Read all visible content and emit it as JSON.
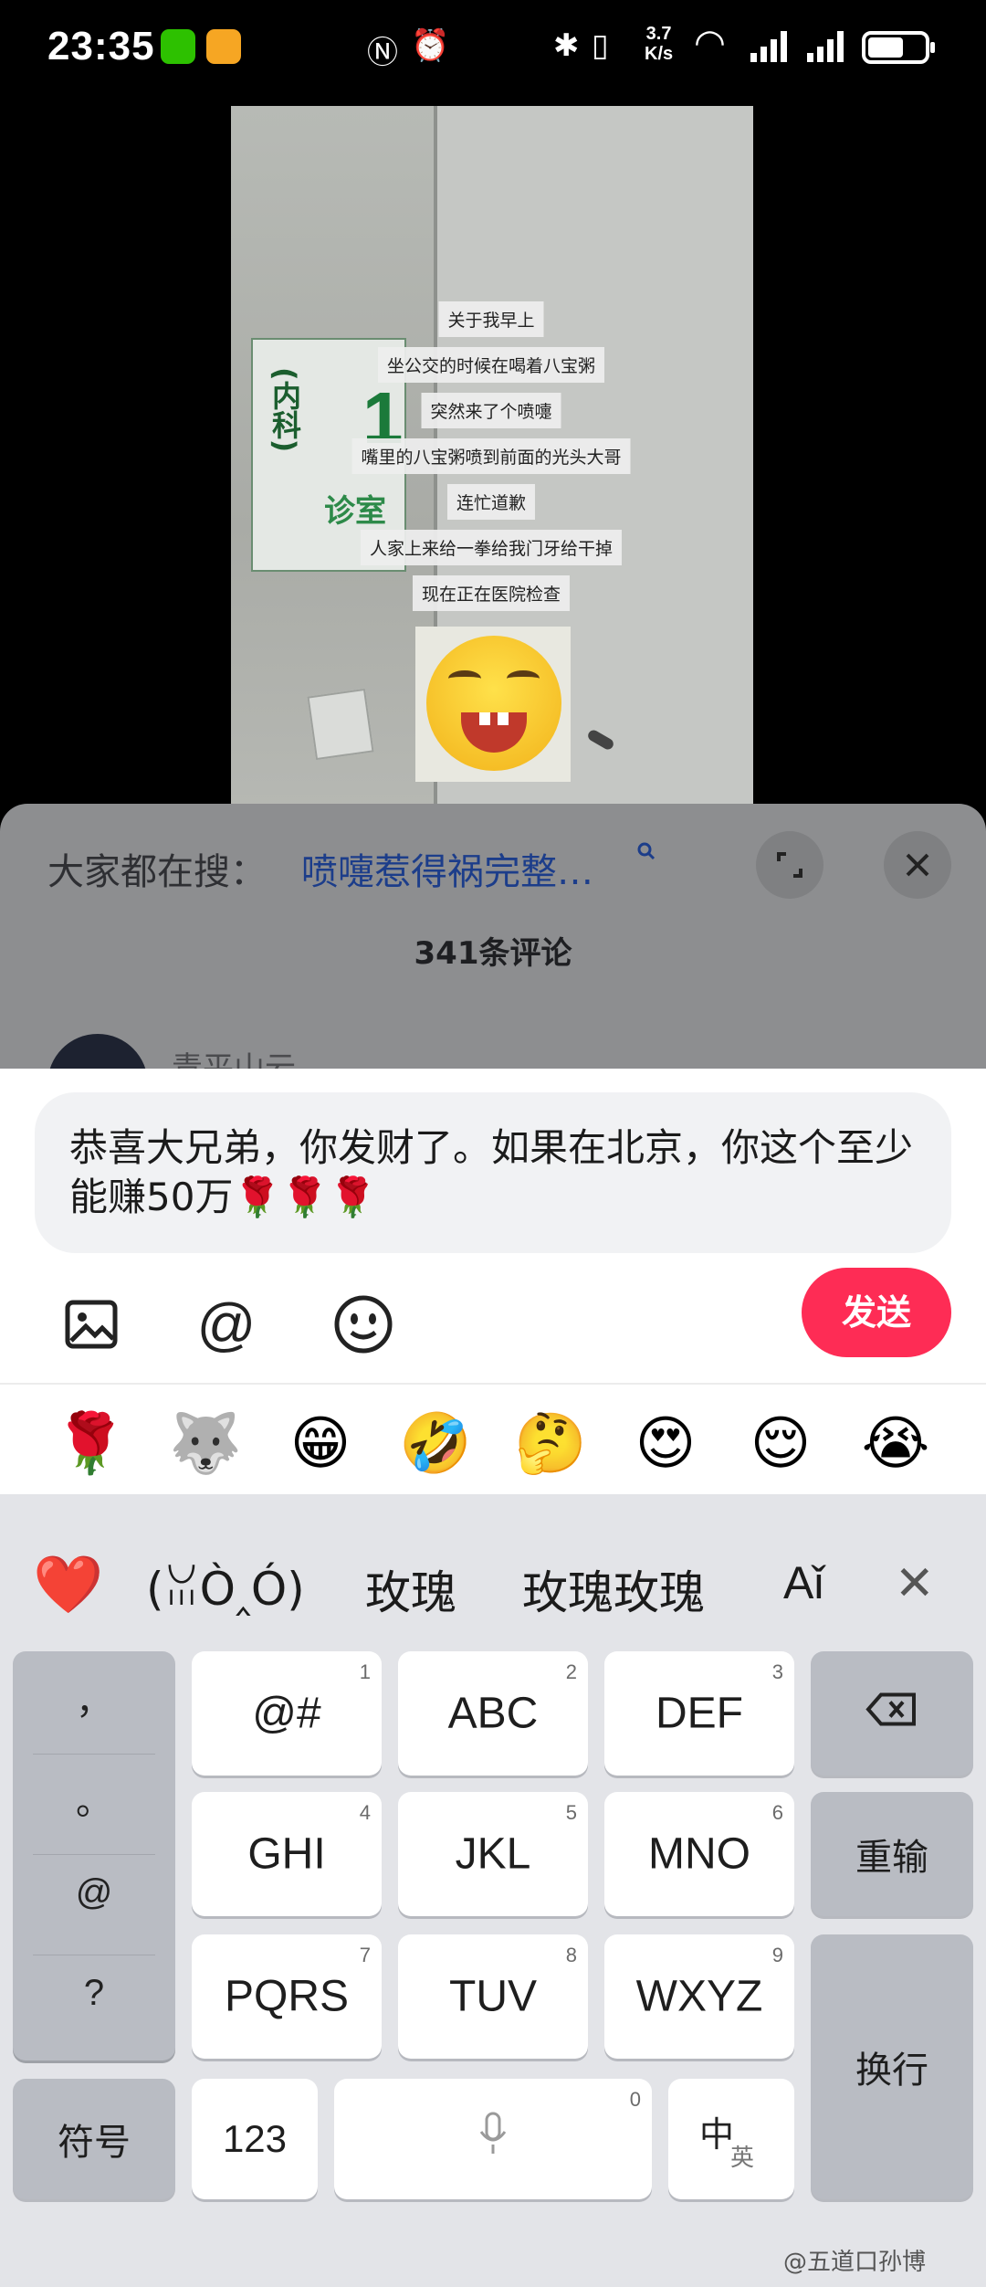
{
  "status_bar": {
    "time": "23:35",
    "net_speed_value": "3.7",
    "net_speed_unit": "K/s",
    "icons": [
      "wechat-icon",
      "weibo-icon",
      "nfc-icon",
      "alarm-icon",
      "bluetooth-icon",
      "vibrate-icon",
      "wifi-icon",
      "signal-icon",
      "signal-icon",
      "battery-icon"
    ]
  },
  "video": {
    "sign_vertical": "(内科)",
    "sign_number": "1",
    "sign_room": "诊室",
    "captions": [
      "关于我早上",
      "坐公交的时候在喝着八宝粥",
      "突然来了个喷嚏",
      "嘴里的八宝粥喷到前面的光头大哥",
      "连忙道歉",
      "人家上来给一拳给我门牙给干掉",
      "现在正在医院检查"
    ]
  },
  "comment_panel": {
    "search_prefix": "大家都在搜：",
    "search_link": "喷嚏惹得祸完整…",
    "comment_count": "341条评论",
    "partial_username": "青平山云"
  },
  "input": {
    "text": "恭喜大兄弟，你发财了。如果在北京，你这个至少能赚50万🌹🌹🌹",
    "send_label": "发送"
  },
  "emoji_bar": [
    "🌹",
    "🐺",
    "😁",
    "🤣",
    "🤔",
    "😍",
    "😌",
    "😭"
  ],
  "keyboard": {
    "candidates": [
      "❤️",
      "(ꈍÒ‸Ó)",
      "玫瑰",
      "玫瑰玫瑰",
      "Aǐ"
    ],
    "punctuation": [
      "，",
      "。",
      "@",
      "?"
    ],
    "rows": [
      [
        {
          "label": "@#",
          "num": "1"
        },
        {
          "label": "ABC",
          "num": "2"
        },
        {
          "label": "DEF",
          "num": "3"
        }
      ],
      [
        {
          "label": "GHI",
          "num": "4"
        },
        {
          "label": "JKL",
          "num": "5"
        },
        {
          "label": "MNO",
          "num": "6"
        }
      ],
      [
        {
          "label": "PQRS",
          "num": "7"
        },
        {
          "label": "TUV",
          "num": "8"
        },
        {
          "label": "WXYZ",
          "num": "9"
        }
      ]
    ],
    "reinput_label": "重输",
    "enter_label": "换行",
    "symbols_label": "符号",
    "num_label": "123",
    "space_num": "0",
    "lang_main": "中",
    "lang_sub": "英"
  },
  "watermark": "@五道口孙博",
  "colors": {
    "send_button": "#fe2c55",
    "search_link": "#1c3d8a",
    "keyboard_bg": "#e3e4e8"
  }
}
